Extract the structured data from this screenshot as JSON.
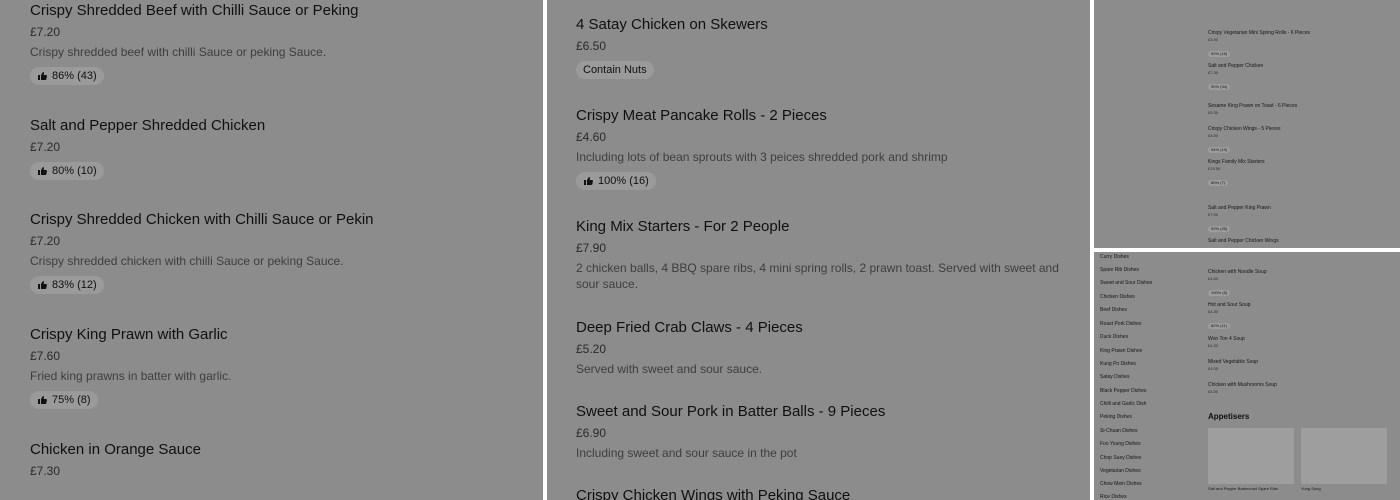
{
  "left_panel": {
    "items": [
      {
        "name": "Crispy Shredded Beef with Chilli Sauce or Peking",
        "price": "£7.20",
        "desc": "Crispy shredded beef with chilli Sauce or peking Sauce.",
        "rating": "86% (43)"
      },
      {
        "name": "Salt and Pepper Shredded Chicken",
        "price": "£7.20",
        "rating": "80% (10)"
      },
      {
        "name": "Crispy Shredded Chicken with Chilli Sauce or Pekin",
        "price": "£7.20",
        "desc": "Crispy shredded chicken with chilli Sauce or peking Sauce.",
        "rating": "83% (12)"
      },
      {
        "name": "Crispy King Prawn with Garlic",
        "price": "£7.60",
        "desc": "Fried king prawns in batter with garlic.",
        "rating": "75% (8)"
      },
      {
        "name": "Chicken in Orange Sauce",
        "price": "£7.30"
      }
    ]
  },
  "mid_panel": {
    "items": [
      {
        "name": "4 Satay Chicken on Skewers",
        "price": "£6.50",
        "tag": "Contain Nuts"
      },
      {
        "name": "Crispy Meat Pancake Rolls - 2 Pieces",
        "price": "£4.60",
        "desc": "Including lots of bean sprouts with 3 peices shredded pork and shrimp",
        "rating": "100% (16)"
      },
      {
        "name": "King Mix Starters - For 2 People",
        "price": "£7.90",
        "desc": "2 chicken balls, 4 BBQ spare ribs, 4 mini spring rolls, 2 prawn toast. Served with sweet and sour sauce."
      },
      {
        "name": "Deep Fried Crab Claws - 4 Pieces",
        "price": "£5.20",
        "desc": "Served with sweet and sour sauce."
      },
      {
        "name": "Sweet and Sour Pork in Batter Balls - 9 Pieces",
        "price": "£6.90",
        "desc": "Including sweet and sour sauce in the pot"
      },
      {
        "name": "Crispy Chicken Wings with Peking Sauce"
      }
    ]
  },
  "right_top_panel": {
    "items": [
      {
        "name": "Crispy Vegetarian Mini Spring Rolls - 6 Pieces",
        "price": "£3.90",
        "rating": "92% (16)"
      },
      {
        "name": "Salt and Pepper Chicken",
        "price": "£7.30",
        "rating": "90% (34)"
      },
      {
        "name": "Sesame King Prawn on Toast - 6 Pieces",
        "price": "£5.30"
      },
      {
        "name": "Crispy Chicken Wings - 5 Pieces",
        "price": "£4.50",
        "rating": "94% (19)"
      },
      {
        "name": "Kings Family Mix Starters",
        "price": "£15.50",
        "rating": "80% (7)"
      },
      {
        "name": "Salt and Pepper King Prawn",
        "price": "£7.90",
        "rating": "92% (25)"
      },
      {
        "name": "Salt and Pepper Chicken Wings"
      }
    ]
  },
  "right_bottom_panel": {
    "categories": [
      "Curry Dishes",
      "Spare Rib Dishes",
      "Sweet and Sour Dishes",
      "Chicken Dishes",
      "Beef Dishes",
      "Roast Pork Dishes",
      "Duck Dishes",
      "King Prawn Dishes",
      "Kung Po Dishes",
      "Satay Dishes",
      "Black Pepper Dishes",
      "Chilli and Garlic Dish",
      "Peking Dishes",
      "Si-Chuan Dishes",
      "Foo Young Dishes",
      "Chop Suey Dishes",
      "Vegetarian Dishes",
      "Chow Mein Dishes",
      "Rice Dishes"
    ],
    "items": [
      {
        "name": "Chicken with Noodle Soup",
        "price": "£4.50",
        "rating": "100% (5)"
      },
      {
        "name": "Hot and Sour Soup",
        "price": "£4.30",
        "rating": "82% (11)"
      },
      {
        "name": "Won Ton 4 Soup",
        "price": "£4.30"
      },
      {
        "name": "Mixed Vegetable Soup",
        "price": "£4.00"
      },
      {
        "name": "Chicken with Mushrooms Soup",
        "price": "£4.50"
      }
    ],
    "heading": "Appetisers",
    "tiles": [
      "Salt and Pepper Barbecued Spare Ribs",
      "Yung Sung"
    ]
  }
}
